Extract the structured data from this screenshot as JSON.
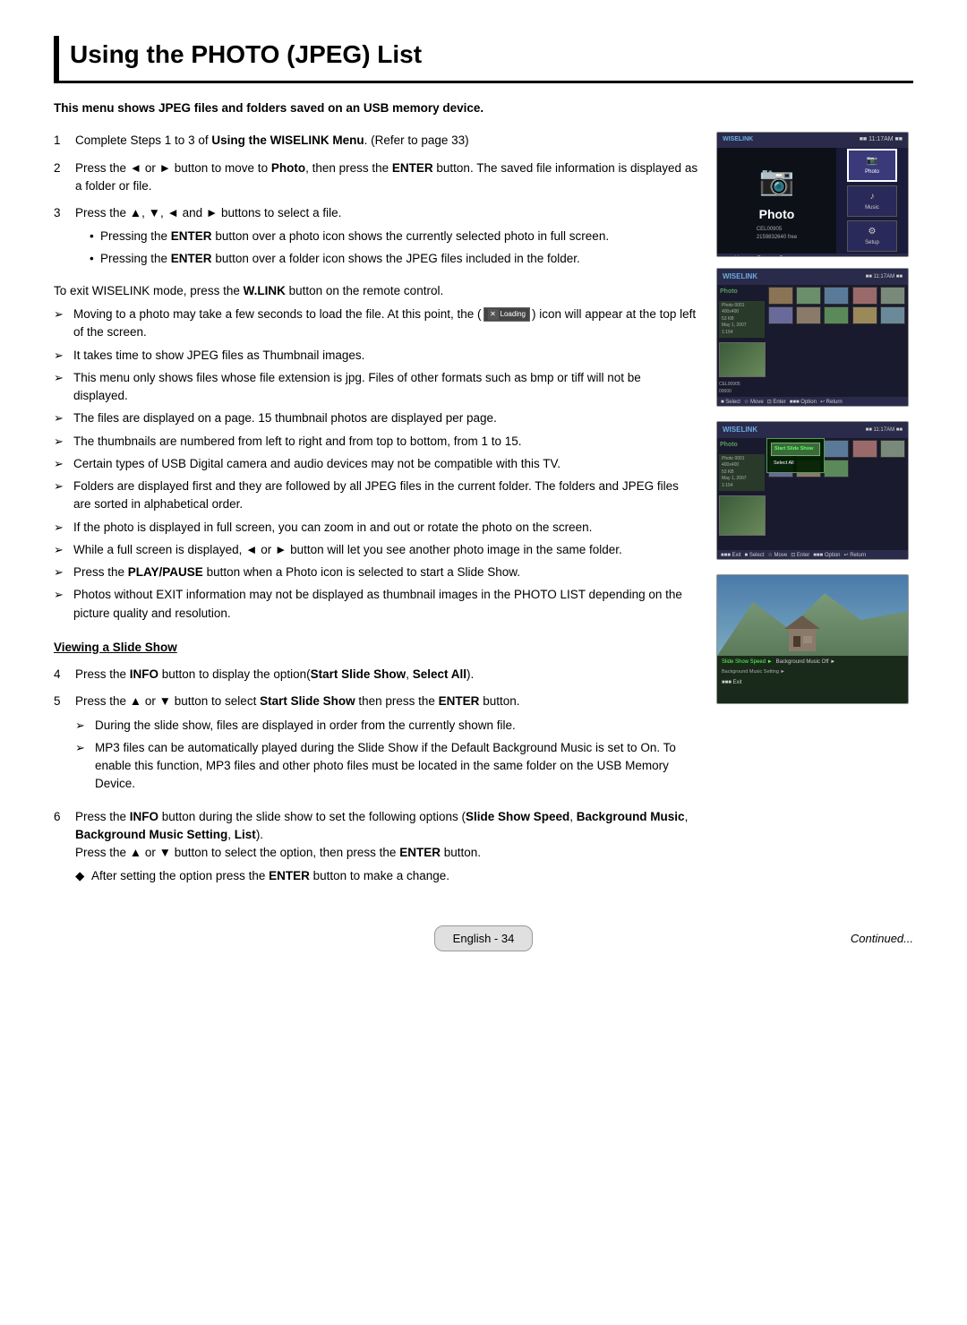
{
  "page": {
    "title": "Using the PHOTO (JPEG) List",
    "intro": "This menu shows JPEG files and folders saved on an USB memory device.",
    "steps": [
      {
        "num": "1",
        "text": "Complete Steps 1 to 3 of ",
        "bold": "Using the WISELINK Menu",
        "after": ". (Refer to page 33)"
      },
      {
        "num": "2",
        "text": "Press the ◄ or ► button to move to ",
        "bold": "Photo",
        "after": ", then press the ",
        "bold2": "ENTER",
        "after2": " button. The saved file information is displayed as a folder or file."
      },
      {
        "num": "3",
        "text": "Press the ▲, ▼, ◄ and ► buttons to select a file.",
        "bullets": [
          "Pressing the ENTER button over a photo icon shows the currently selected photo in full screen.",
          "Pressing the ENTER button over a folder icon shows the JPEG files included in the folder."
        ]
      }
    ],
    "notes_intro": "To exit WISELINK mode, press the W.LINK button on the remote control.",
    "arrows": [
      "Moving to a photo may take a few seconds to load the file. At this point, the ( [X Loading] ) icon will appear at the top left of the screen.",
      "It takes time to show JPEG files as Thumbnail images.",
      "This menu only shows files whose file extension is jpg. Files of other formats such as bmp or tiff will not be displayed.",
      "The files are displayed on a page. 15 thumbnail photos are displayed per page.",
      "The thumbnails are numbered from left to right and from top to bottom, from 1 to 15.",
      "Certain types of USB Digital camera and audio devices may not be compatible with this TV.",
      "Folders are displayed first and they are followed by all JPEG files in the current folder. The folders and JPEG files are sorted in alphabetical order.",
      "If the photo is displayed in full screen, you can zoom in and out or rotate the photo on the screen.",
      "While a full screen is displayed, ◄ or ► button will let you see another photo image in the same folder.",
      "Press the PLAY/PAUSE button when a Photo icon is selected to start a Slide Show.",
      "Photos without EXIT information may not be displayed as thumbnail images in the PHOTO LIST depending on the picture quality and resolution."
    ],
    "viewing_heading": "Viewing a Slide Show",
    "steps2": [
      {
        "num": "4",
        "text": "Press the ",
        "bold": "INFO",
        "after": " button to display the option(",
        "bold2": "Start Slide Show",
        "after2": ", ",
        "bold3": "Select All",
        "after3": ")."
      },
      {
        "num": "5",
        "text": "Press the ▲ or ▼ button to select ",
        "bold": "Start Slide Show",
        "after": " then press the ",
        "bold2": "ENTER",
        "after2": " button.",
        "arrows": [
          "During the slide show, files are displayed in order from the currently shown file.",
          "MP3 files can be automatically played during the Slide Show if the Default Background Music is set to On. To enable this function, MP3 files and other photo files must be located in the same folder on the USB Memory Device."
        ]
      },
      {
        "num": "6",
        "text": "Press the ",
        "bold": "INFO",
        "after": " button during the slide show to set the following options (",
        "bold2": "Slide Show Speed",
        "after2": ", ",
        "bold3": "Background Music",
        "after3": ", ",
        "bold4": "Background Music Setting",
        "after4": ", ",
        "bold5": "List",
        "after5": ").",
        "sub": "Press the ▲ or ▼ button to select the option, then press the ",
        "sub_bold": "ENTER",
        "sub_after": " button.",
        "diamond": "After setting the option press the ENTER button to make a change."
      }
    ],
    "footer": {
      "english_label": "English - 34",
      "continued": "Continued..."
    },
    "screens": {
      "screen1": {
        "brand": "WISELINK",
        "title": "Photo",
        "menu_items": [
          "Photo",
          "Music",
          "Setup"
        ]
      },
      "screen2": {
        "brand": "WISELINK",
        "title": "Photo",
        "file_label": "Photo 0001"
      },
      "screen3": {
        "brand": "WISELINK",
        "title": "Photo",
        "file_label": "Photo 0001",
        "menu_items": [
          "Start Slide Show",
          "Select All"
        ]
      },
      "screen4": {
        "options": [
          "Slide Show Speed",
          "Background Music Off",
          "Background Music Setting"
        ]
      }
    }
  }
}
